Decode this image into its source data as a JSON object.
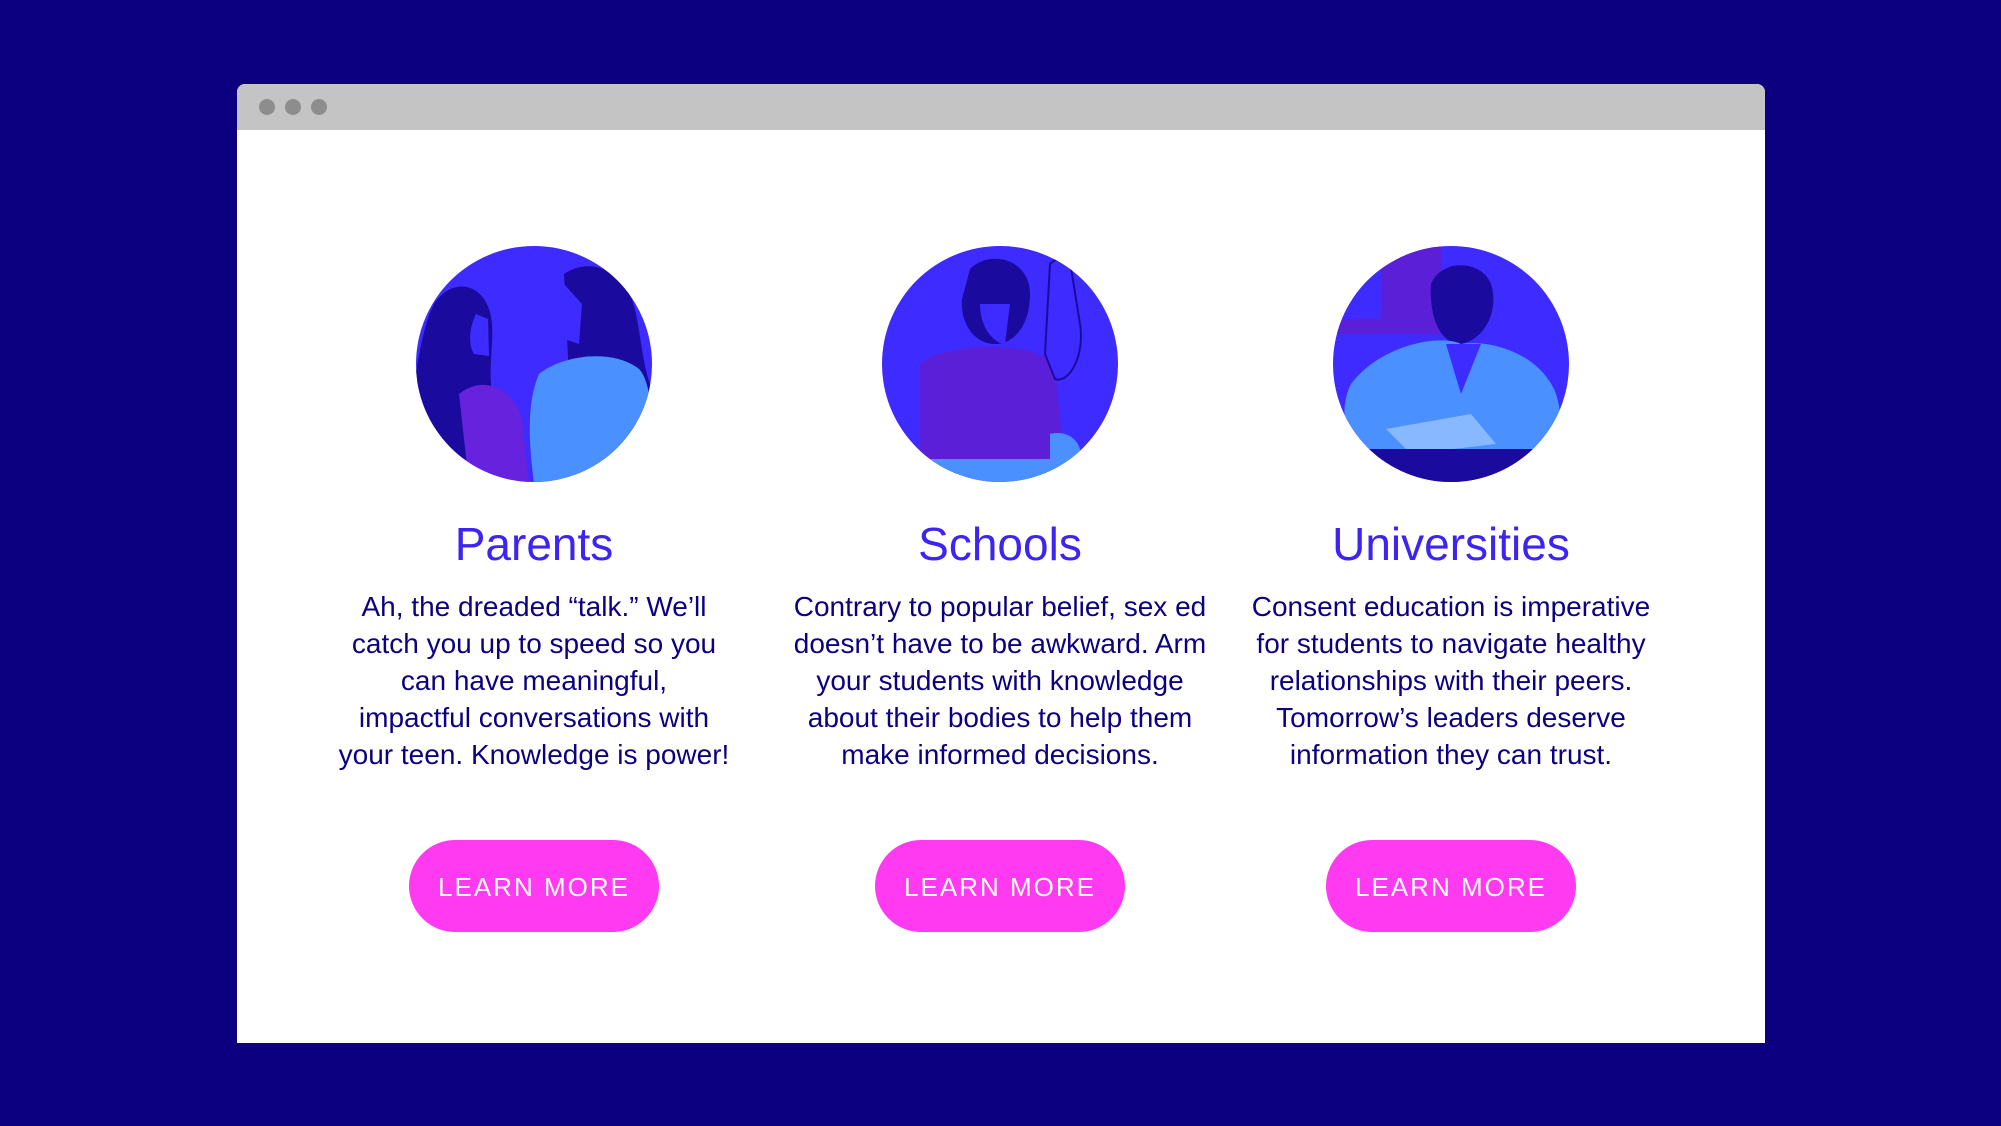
{
  "window": {
    "controls": [
      "window-dot",
      "window-dot",
      "window-dot"
    ]
  },
  "colors": {
    "page_background": "#0c0080",
    "window_background": "#ffffff",
    "titlebar": "#c4c4c4",
    "title_text": "#3d24f2",
    "body_text": "#0c0080",
    "button": "#ff3af0",
    "button_text": "#ffffff"
  },
  "cards": [
    {
      "title": "Parents",
      "illustration": "parent-and-teen-illustration",
      "lines": [
        "Ah, the dreaded “talk.” We’ll",
        "catch you up to speed so you",
        "can have meaningful,",
        "impactful conversations with",
        "your teen. Knowledge is power!"
      ],
      "button": "LEARN MORE"
    },
    {
      "title": "Schools",
      "illustration": "student-raising-hand-illustration",
      "lines": [
        "Contrary to popular belief, sex ed",
        "doesn’t have to be awkward. Arm",
        "your students with knowledge",
        "about their bodies to help them",
        "make informed decisions."
      ],
      "button": "LEARN MORE"
    },
    {
      "title": "Universities",
      "illustration": "university-student-reading-illustration",
      "lines": [
        "Consent education is imperative",
        "for students to navigate healthy",
        "relationships with their peers.",
        "Tomorrow’s leaders deserve",
        "information they can trust."
      ],
      "button": "LEARN MORE"
    }
  ]
}
